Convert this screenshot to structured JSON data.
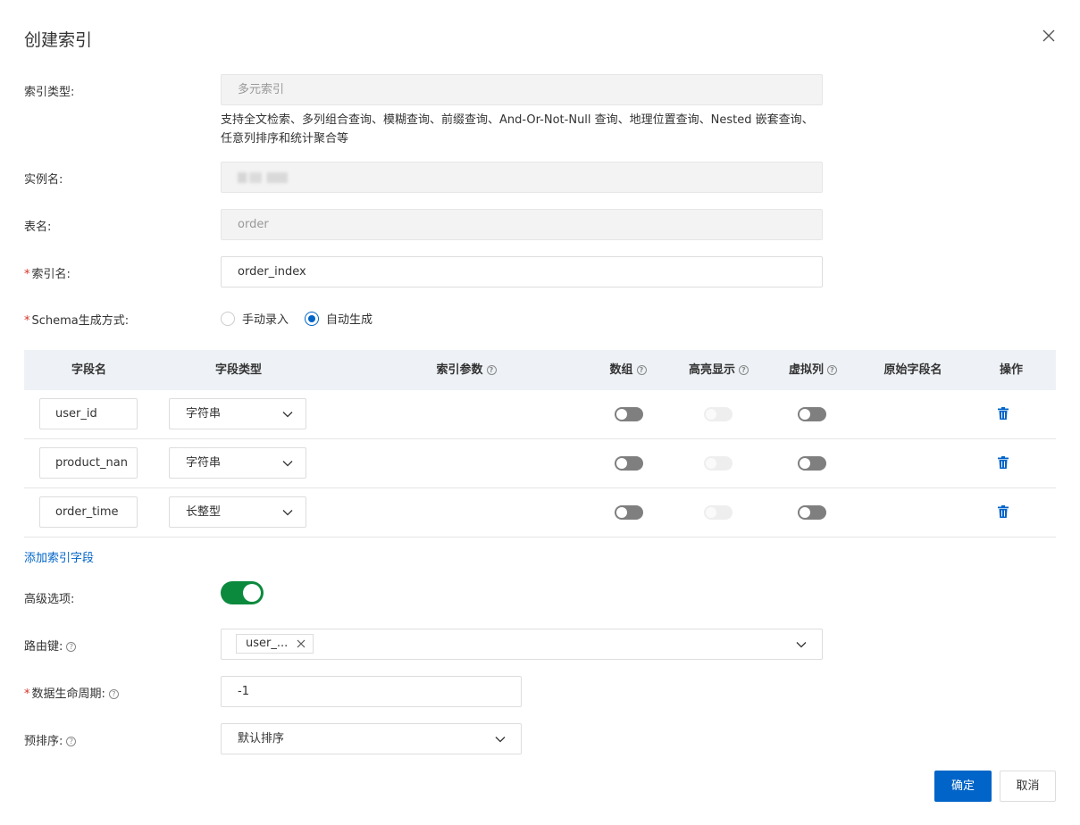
{
  "dialog": {
    "title": "创建索引",
    "close_label": "×"
  },
  "form": {
    "index_type": {
      "label": "索引类型:",
      "value": "多元索引",
      "desc_line1": "支持全文检索、多列组合查询、模糊查询、前缀查询、And-Or-Not-Null 查询、地理位置查询、Nested 嵌套查询、",
      "desc_line2": "任意列排序和统计聚合等"
    },
    "instance": {
      "label": "实例名:"
    },
    "table": {
      "label": "表名:",
      "value": "order"
    },
    "index_name": {
      "label": "索引名:",
      "value": "order_index",
      "required_mark": "*"
    },
    "schema": {
      "label": "Schema生成方式:",
      "required_mark": "*",
      "options": [
        "手动录入",
        "自动生成"
      ],
      "selected": "自动生成"
    }
  },
  "table": {
    "headers": {
      "field_name": "字段名",
      "field_type": "字段类型",
      "index_params": "索引参数",
      "array": "数组",
      "highlight": "高亮显示",
      "virtual": "虚拟列",
      "source_field": "原始字段名",
      "action": "操作"
    },
    "rows": [
      {
        "name": "user_id",
        "type": "字符串",
        "array": false,
        "highlight": false,
        "virtual": false
      },
      {
        "name": "product_nan",
        "type": "字符串",
        "array": false,
        "highlight": false,
        "virtual": false
      },
      {
        "name": "order_time",
        "type": "长整型",
        "array": false,
        "highlight": false,
        "virtual": false
      }
    ],
    "add_field_label": "添加索引字段"
  },
  "advanced": {
    "label": "高级选项:",
    "enabled": true,
    "routing_key": {
      "label": "路由键:",
      "tag": "user_..."
    },
    "ttl": {
      "label": "数据生命周期:",
      "value": "-1",
      "required_mark": "*"
    },
    "presort": {
      "label": "预排序:",
      "value": "默认排序"
    }
  },
  "footer": {
    "confirm_label": "确定",
    "cancel_label": "取消"
  },
  "colors": {
    "primary": "#0064c8",
    "toggle_on": "#0b8a3e",
    "required": "#d93026"
  }
}
